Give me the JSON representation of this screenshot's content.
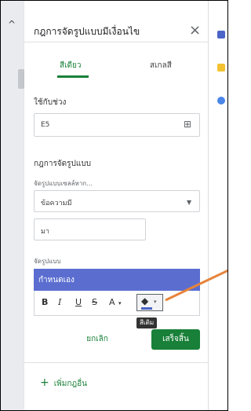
{
  "panel": {
    "title": "กฎการจัดรูปแบบมีเงื่อนไข",
    "close_glyph": "×",
    "tabs": [
      {
        "label": "สีเดียว",
        "active": true
      },
      {
        "label": "สเกลสี",
        "active": false
      }
    ]
  },
  "apply_range": {
    "label": "ใช้กับช่วง",
    "value": "E5"
  },
  "rules": {
    "heading": "กฎการจัดรูปแบบ",
    "condition_label": "จัดรูปแบบเซลล์หาก...",
    "condition_value": "ข้อความมี",
    "text_value": "มา"
  },
  "format": {
    "label": "จัดรูปแบบ",
    "preview_text": "กำหนดเอง",
    "preview_color": "#5b6ed0",
    "toolbar": {
      "bold": "B",
      "italic": "I",
      "underline": "U",
      "strike": "S",
      "text_color": "A",
      "text_color_caret": "▾",
      "fill_caret": "▾"
    },
    "tooltip": "สีเติม"
  },
  "buttons": {
    "cancel": "ยกเลิก",
    "done": "เสร็จสิ้น"
  },
  "add_rule": {
    "plus": "+",
    "label": "เพิ่มกฎอื่น"
  },
  "colors": {
    "accent": "#188038",
    "arrow": "#e8833a"
  }
}
